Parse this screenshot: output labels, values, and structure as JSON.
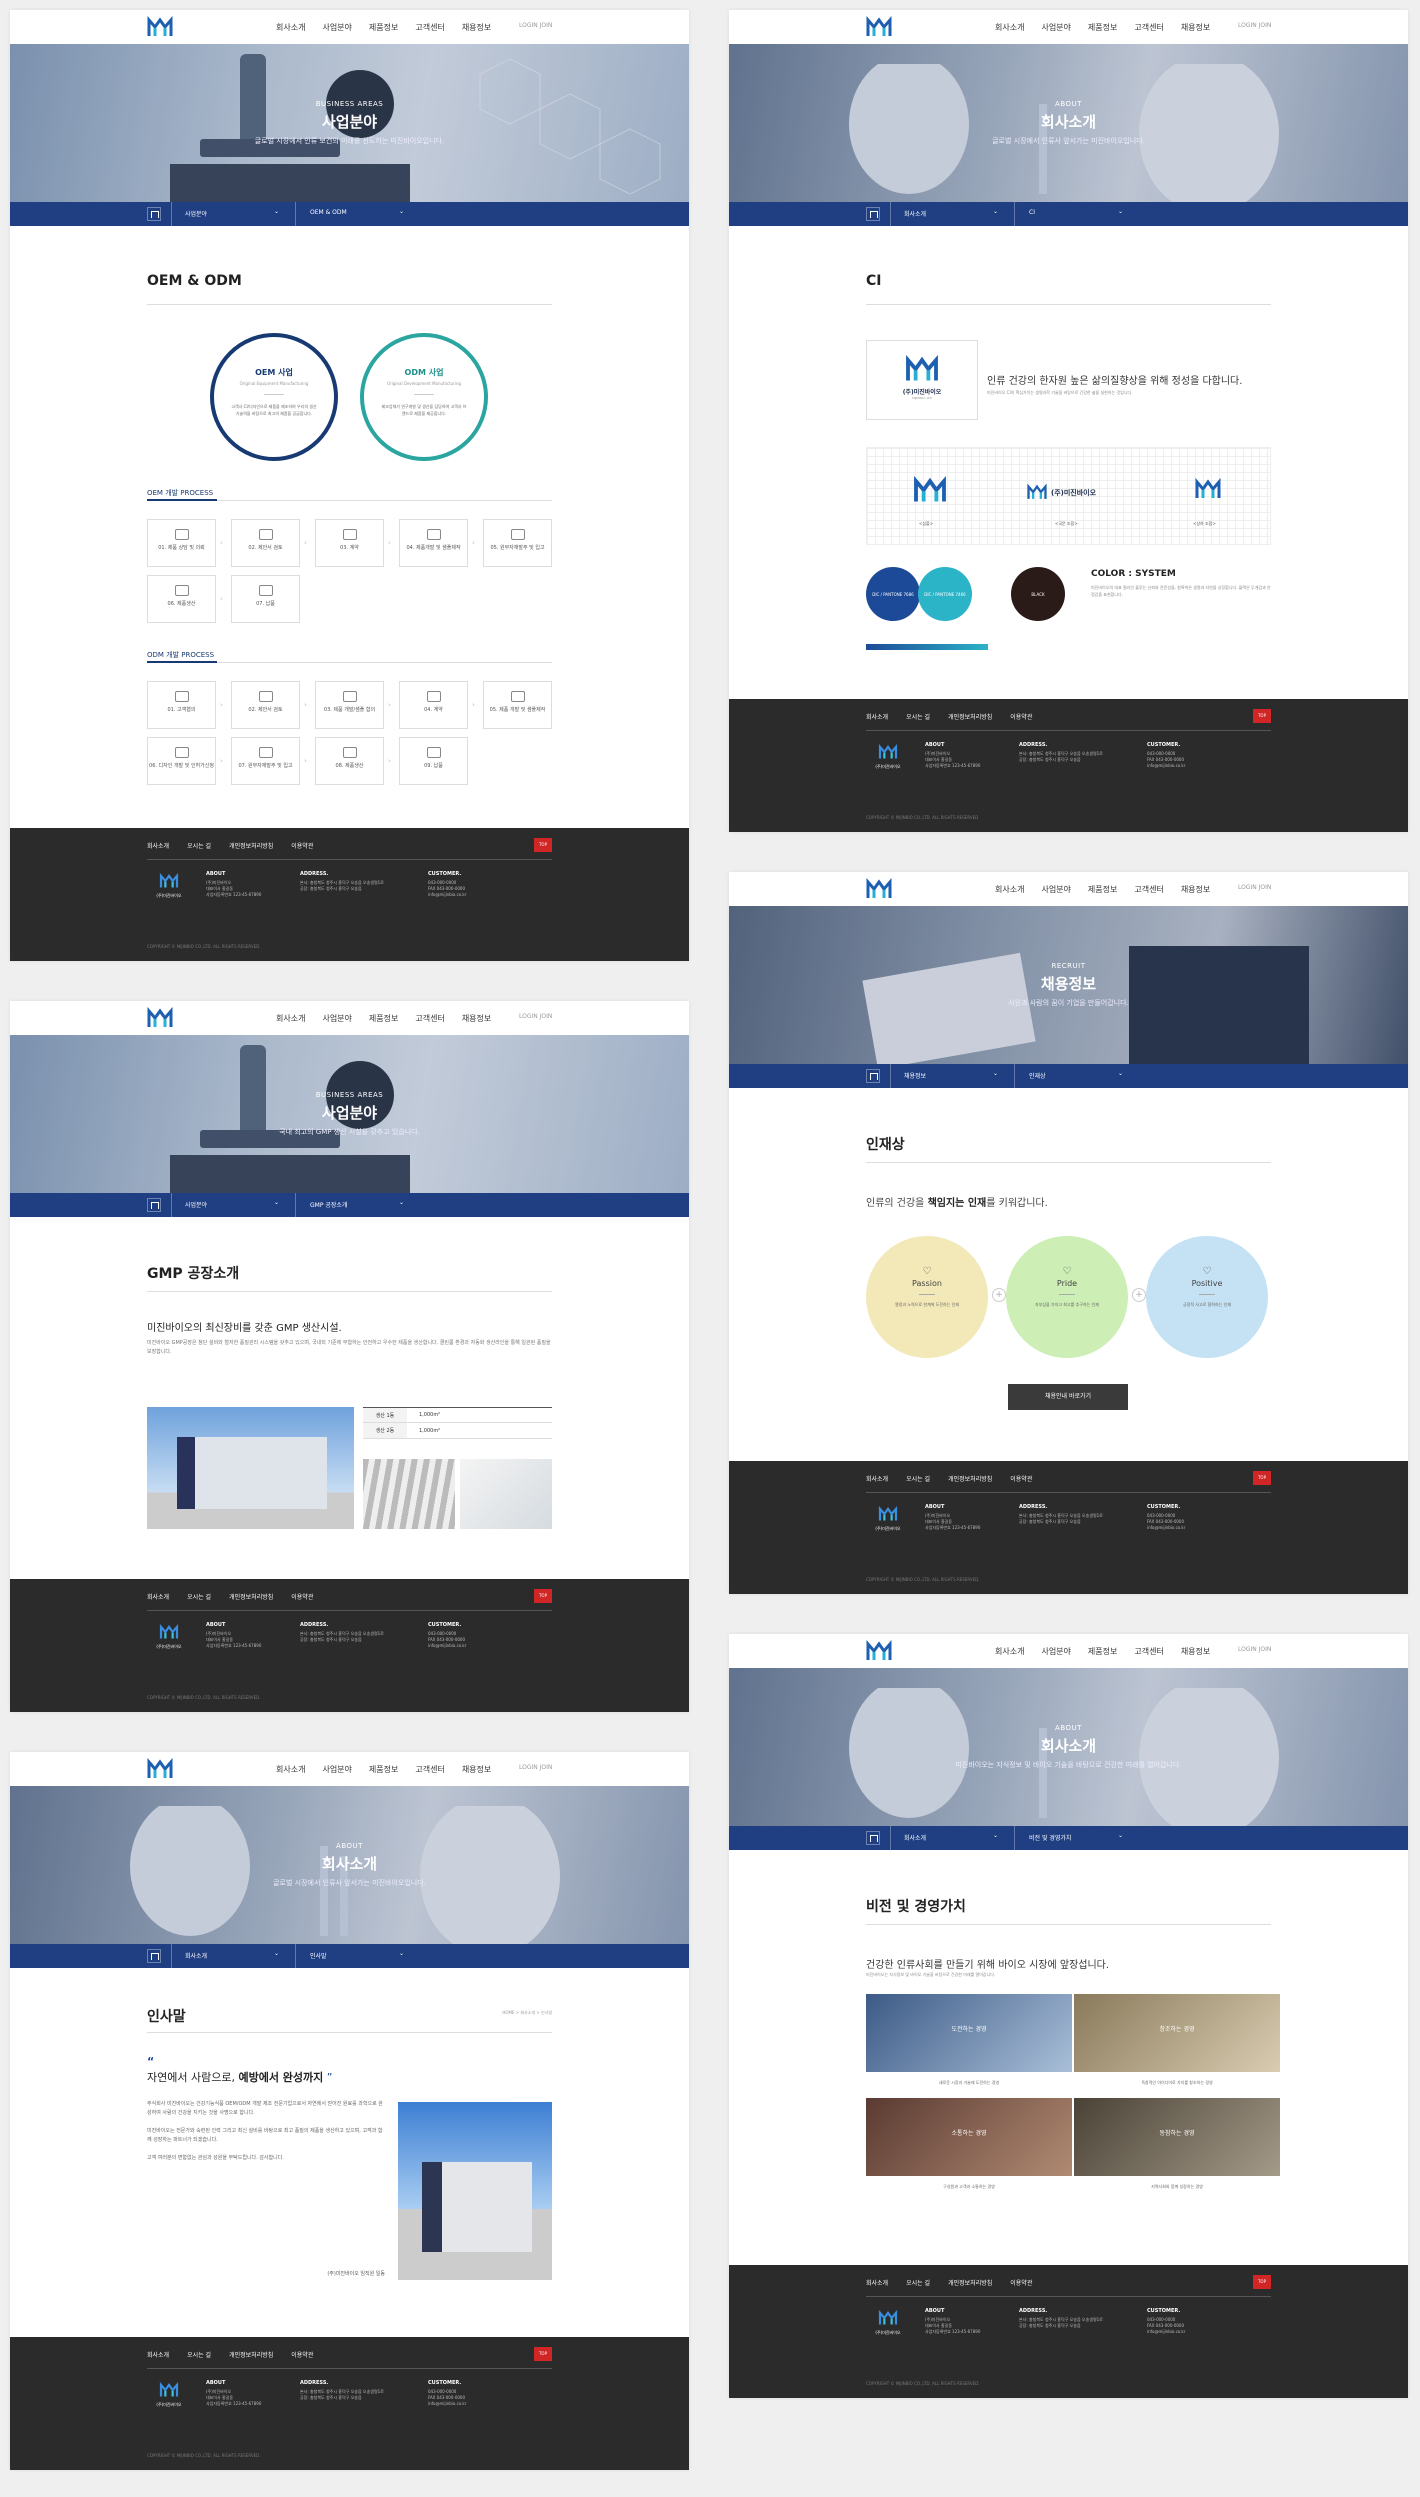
{
  "nav": {
    "menu": [
      "회사소개",
      "사업분야",
      "제품정보",
      "고객센터",
      "채용정보"
    ],
    "lang": "LOGIN   JOIN"
  },
  "footer": {
    "menu": [
      "회사소개",
      "오시는 길",
      "개인정보처리방침",
      "이용약관"
    ],
    "top": "TOP",
    "logo_text": "(주)미진바이오",
    "about_title": "ABOUT",
    "about_lines": [
      "(주)미진바이오",
      "대표이사 홍길동",
      "사업자등록번호 123-45-67890"
    ],
    "address_title": "ADDRESS.",
    "address_lines": [
      "본사: 충청북도 청주시 흥덕구 오송읍 오송생명1로",
      "공장: 충청북도 청주시 흥덕구 오송읍"
    ],
    "customer_title": "CUSTOMER.",
    "customer_lines": [
      "043-000-0000",
      "FAX 043-000-0000",
      "info@mijinbio.co.kr"
    ],
    "copyright": "COPYRIGHT © MIJINBIO CO.,LTD. ALL RIGHTS RESERVED."
  },
  "p1": {
    "sm": "BUSINESS AREAS",
    "title": "사업분야",
    "desc": "글로벌 시장에서 인류 보건의 미래를 선도하는 미진바이오입니다.",
    "crumb1": "사업분야",
    "crumb2": "OEM & ODM",
    "h2": "OEM & ODM",
    "oem": {
      "title": "OEM 사업",
      "en": "Original Equipment Manufacturing",
      "desc": "고객사 CI/디자인으로 제품을 제조하여 우리의 생산 기술력을 바탕으로 최고의 제품을 공급합니다."
    },
    "odm": {
      "title": "ODM 사업",
      "en": "Original Development Manufacturing",
      "desc": "제조업체가 연구개발 및 생산을 담당하여 고객사 브랜드로 제품을 제공합니다."
    },
    "proc1_title": "OEM 개발 PROCESS",
    "proc1": [
      "01. 제품 상담 및 의뢰",
      "02. 제안서 검토",
      "03. 계약",
      "04. 제품개발 및 샘플제작",
      "05. 원부자재발주 및 입고",
      "06. 제품생산",
      "07. 납품"
    ],
    "proc2_title": "ODM 개발 PROCESS",
    "proc2": [
      "01. 고객협의",
      "02. 제안서 검토",
      "03. 제품 개발/샘플 합의",
      "04. 계약",
      "05. 제품 개발 및 샘플제작",
      "06. 디자인 개발 및 인허가신청",
      "07. 원부자재발주 및 입고",
      "08. 제품생산",
      "09. 납품"
    ]
  },
  "p2": {
    "sm": "BUSINESS AREAS",
    "title": "사업분야",
    "desc": "국내 최고의 GMP 생산 시설을 갖추고 있습니다.",
    "crumb1": "사업분야",
    "crumb2": "GMP 공장소개",
    "h2": "GMP 공장소개",
    "lead": "미진바이오의 최신장비를 갖춘 GMP 생산시설.",
    "body": "미진바이오 GMP공장은 첨단 설비와 철저한 품질관리 시스템을 갖추고 있으며, 국내외 기준에 부합하는 안전하고 우수한 제품을 생산합니다. 클린룸 환경과 자동화 생산라인을 통해 일관된 품질을 보장합니다.",
    "tbl": [
      [
        "생산 1동",
        "1,000m²"
      ],
      [
        "생산 2동",
        "1,000m²"
      ]
    ]
  },
  "p3": {
    "sm": "ABOUT",
    "title": "회사소개",
    "desc": "글로벌 시장에서 인류사 앞서가는 미진바이오입니다.",
    "crumb1": "회사소개",
    "crumb2": "인사말",
    "h2": "인사말",
    "loc": "HOME > 회사소개 > 인사말",
    "quote1": "자연에서 사람으로, ",
    "quote2": "예방에서 완성까지",
    "body1": "주식회사 미진바이오는 건강기능식품 OEM/ODM 개발 제조 전문기업으로서 자연에서 얻어진 원료를 과학으로 완성하여 사람의 건강을 지키는 것을 사명으로 합니다.",
    "body2": "미진바이오는 전문가와 숙련된 인력 그리고 최신 설비를 바탕으로 최고 품질의 제품을 생산하고 있으며, 고객과 함께 성장하는 파트너가 되겠습니다.",
    "body3": "고객 여러분의 변함없는 관심과 성원을 부탁드립니다. 감사합니다.",
    "sign": "(주)미진바이오 임직원 일동"
  },
  "p4": {
    "sm": "ABOUT",
    "title": "회사소개",
    "desc": "글로벌 시장에서 인류사 앞서가는 미진바이오입니다.",
    "crumb1": "회사소개",
    "crumb2": "CI",
    "h2": "CI",
    "lead": "인류 건강의 한자원 높은 삶의질향상을 위해 정성을 다합니다.",
    "desc2": "미진바이오 CI의 핵심가치는 생명과학 기술을 바탕으로 건강한 삶을 실현하는 것입니다.",
    "logo_name": "(주)미진바이오",
    "logo_sub": "MIJINBIO.,LTD",
    "marks": [
      "<심볼>",
      "<국문 조합>",
      "<상하 조합>"
    ],
    "color_title": "COLOR : SYSTEM",
    "color_desc": "미진바이오의 대표 컬러인 블루는 신뢰와 전문성을, 청록색은 생명과 자연을 상징합니다. 블랙은 무게감과 안정감을 표현합니다.",
    "colors": [
      {
        "name": "DIC / PANTONE 7686",
        "hex": "#1d4a98"
      },
      {
        "name": "DIC / PANTONE 7466",
        "hex": "#2bb3c8"
      },
      {
        "name": "BLACK",
        "hex": "#2a1a18"
      }
    ]
  },
  "p5": {
    "sm": "RECRUIT",
    "title": "채용정보",
    "desc": "사원과 사람의 꿈이 기업을 만들어갑니다.",
    "crumb1": "채용정보",
    "crumb2": "인재상",
    "h2": "인재상",
    "lead1": "인류의 건강을 ",
    "lead2": "책임지는 인재",
    "lead3": "를 키워갑니다.",
    "circles": [
      {
        "t": "Passion",
        "d": "열정과 노력으로 한계에 도전하는 인재",
        "bg": "#f3e8b8"
      },
      {
        "t": "Pride",
        "d": "자부심을 가지고 최고를 추구하는 인재",
        "bg": "#cdeeb4"
      },
      {
        "t": "Positive",
        "d": "긍정적 사고로 협력하는 인재",
        "bg": "#c4e2f3"
      }
    ],
    "btn": "채용안내 바로가기"
  },
  "p6": {
    "sm": "ABOUT",
    "title": "회사소개",
    "desc": "미진바이오는 지식정보 및 바이오 기술을 바탕으로 건강한 미래를 열어갑니다.",
    "crumb1": "회사소개",
    "crumb2": "비전 및 경영가치",
    "h2": "비전 및 경영가치",
    "lead": "건강한 인류사회를 만들기 위해 바이오 시장에 앞장섭니다.",
    "vals": [
      {
        "t": "도전하는 경영",
        "d": "새로운 시장과 기술에 도전하는 경영"
      },
      {
        "t": "창조하는 경영",
        "d": "독창적인 아이디어로 가치를 창조하는 경영"
      },
      {
        "t": "소통하는 경영",
        "d": "구성원과 고객과 소통하는 경영"
      },
      {
        "t": "동참하는 경영",
        "d": "지역사회와 함께 성장하는 경영"
      }
    ]
  }
}
